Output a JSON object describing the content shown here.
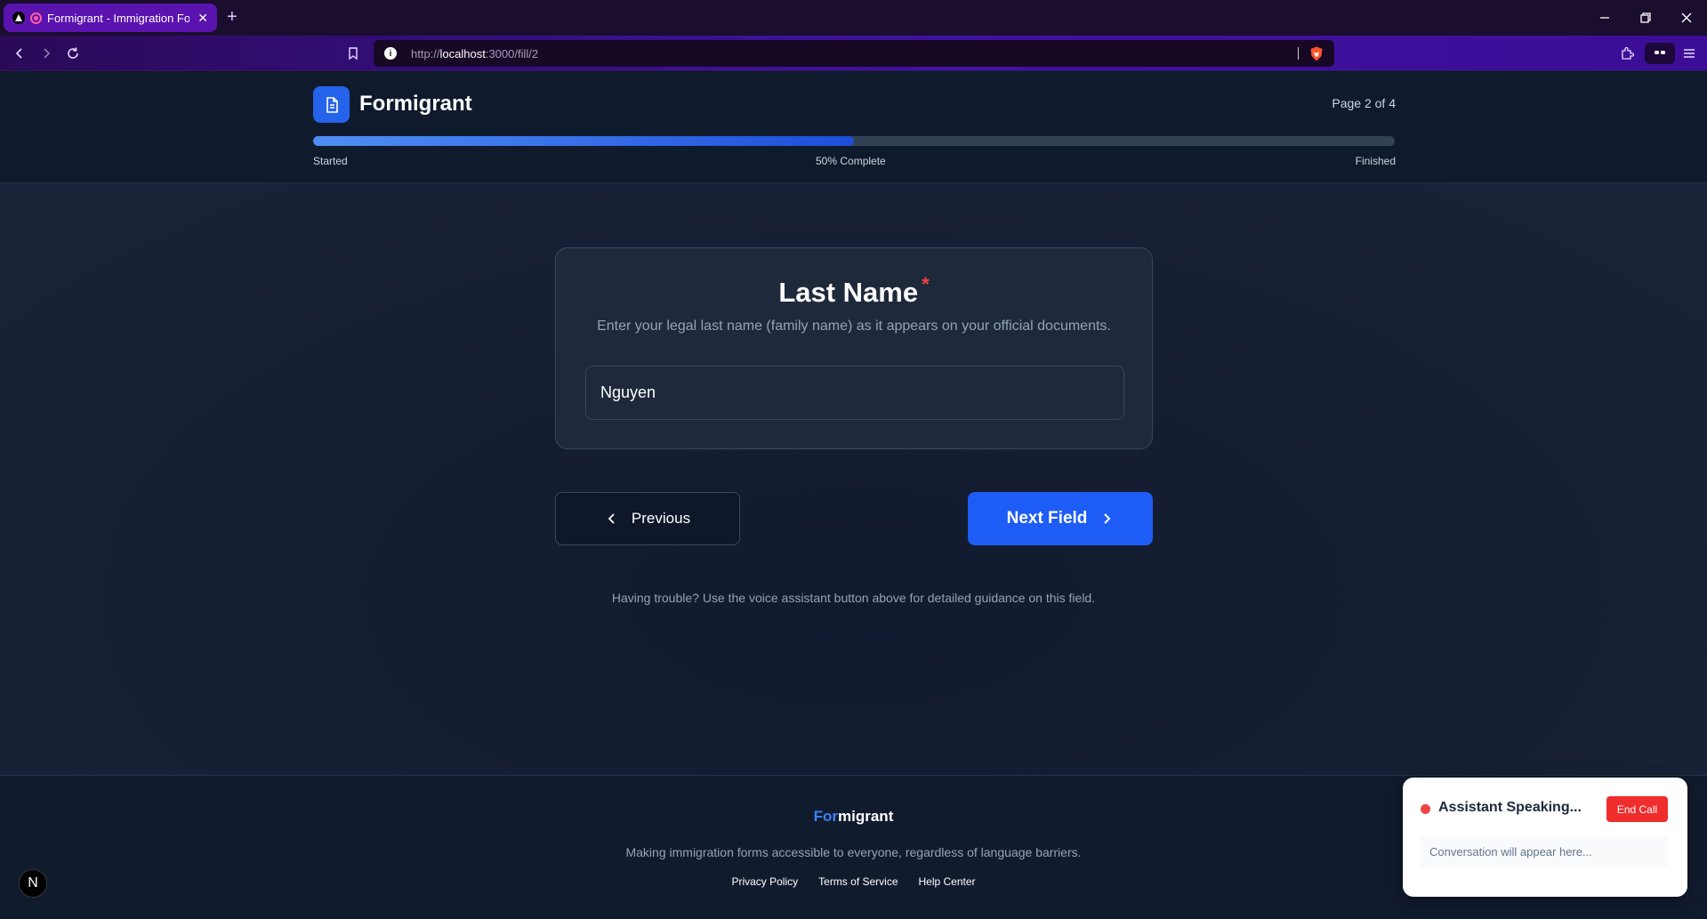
{
  "browser": {
    "tab_title": "Formigrant - Immigration For",
    "new_tab_symbol": "+",
    "url_prefix": "http://",
    "url_host": "localhost",
    "url_path": ":3000/fill/2"
  },
  "header": {
    "brand": "Formigrant",
    "page_indicator": "Page 2 of 4",
    "progress_percent": 50,
    "progress_start": "Started",
    "progress_mid": "50% Complete",
    "progress_end": "Finished"
  },
  "field": {
    "title": "Last Name",
    "required_mark": "*",
    "description": "Enter your legal last name (family name) as it appears on your official documents.",
    "value": "Nguyen"
  },
  "nav": {
    "previous_label": "Previous",
    "next_label": "Next Field"
  },
  "hint": "Having trouble? Use the voice assistant button above for detailed guidance on this field.",
  "footer": {
    "brand_highlight": "For",
    "brand_rest": "migrant",
    "tagline": "Making immigration forms accessible to everyone, regardless of language barriers.",
    "links": [
      "Privacy Policy",
      "Terms of Service",
      "Help Center"
    ]
  },
  "assistant": {
    "status": "Assistant Speaking...",
    "end_call": "End Call",
    "conversation_placeholder": "Conversation will appear here..."
  },
  "badge": "N",
  "colors": {
    "accent": "#1d5cf5",
    "required": "#ef4444",
    "end_call": "#ef2d2d"
  }
}
